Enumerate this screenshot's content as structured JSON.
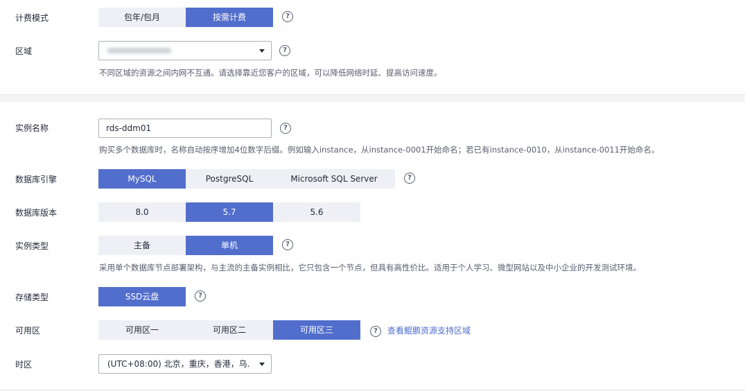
{
  "billing": {
    "label": "计费模式",
    "options": [
      "包年/包月",
      "按需计费"
    ],
    "selected": "按需计费"
  },
  "region": {
    "label": "区域",
    "value": "",
    "hint": "不同区域的资源之间内网不互通。请选择靠近您客户的区域，可以降低网络时延、提高访问速度。"
  },
  "instance_name": {
    "label": "实例名称",
    "value": "rds-ddm01",
    "hint": "购买多个数据库时，名称自动按序增加4位数字后缀。例如输入instance，从instance-0001开始命名；若已有instance-0010，从instance-0011开始命名。"
  },
  "db_engine": {
    "label": "数据库引擎",
    "options": [
      "MySQL",
      "PostgreSQL",
      "Microsoft SQL Server"
    ],
    "selected": "MySQL"
  },
  "db_version": {
    "label": "数据库版本",
    "options": [
      "8.0",
      "5.7",
      "5.6"
    ],
    "selected": "5.7"
  },
  "instance_type": {
    "label": "实例类型",
    "options": [
      "主备",
      "单机"
    ],
    "selected": "单机",
    "hint": "采用单个数据库节点部署架构，与主流的主备实例相比，它只包含一个节点，但具有高性价比。适用于个人学习、微型网站以及中小企业的开发测试环境。"
  },
  "storage_type": {
    "label": "存储类型",
    "options": [
      "SSD云盘"
    ],
    "selected": "SSD云盘"
  },
  "az": {
    "label": "可用区",
    "options": [
      "可用区一",
      "可用区二",
      "可用区三"
    ],
    "selected": "可用区三",
    "link": "查看鲲鹏资源支持区域"
  },
  "timezone": {
    "label": "时区",
    "value": "(UTC+08:00) 北京，重庆，香港，乌..."
  },
  "help_glyph": "?",
  "colors": {
    "accent": "#526ecc",
    "segment_bg": "#eef0f5",
    "hint_text": "#575d6c"
  }
}
